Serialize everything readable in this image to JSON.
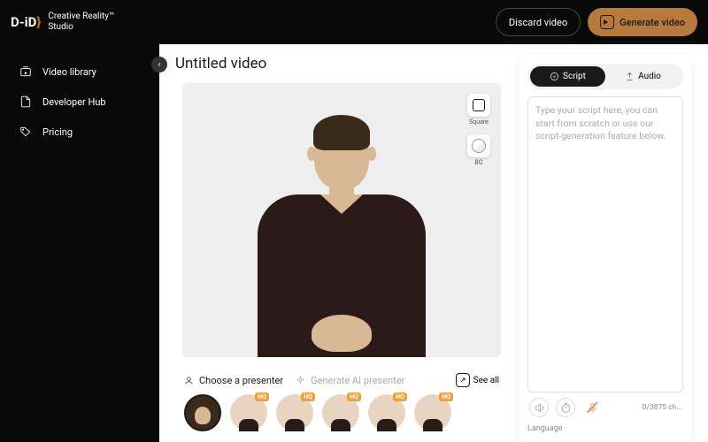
{
  "header": {
    "brand_main": "D-iD",
    "brand_sub_line1": "Creative Reality™",
    "brand_sub_line2": "Studio",
    "discard_label": "Discard video",
    "generate_label": "Generate video"
  },
  "sidebar": {
    "items": [
      {
        "label": "Video library"
      },
      {
        "label": "Developer Hub"
      },
      {
        "label": "Pricing"
      }
    ]
  },
  "editor": {
    "title": "Untitled video",
    "tool_square": "Square",
    "tool_bg": "BG"
  },
  "presenter_strip": {
    "choose_label": "Choose a presenter",
    "generate_label": "Generate AI presenter",
    "seeall_label": "See all",
    "hq_badge": "HQ"
  },
  "panel": {
    "tab_script": "Script",
    "tab_audio": "Audio",
    "script_placeholder": "Type your script here, you can start from scratch or use our script-generation feature below.",
    "counter": "0/3875 ch…",
    "language_label": "Language"
  }
}
